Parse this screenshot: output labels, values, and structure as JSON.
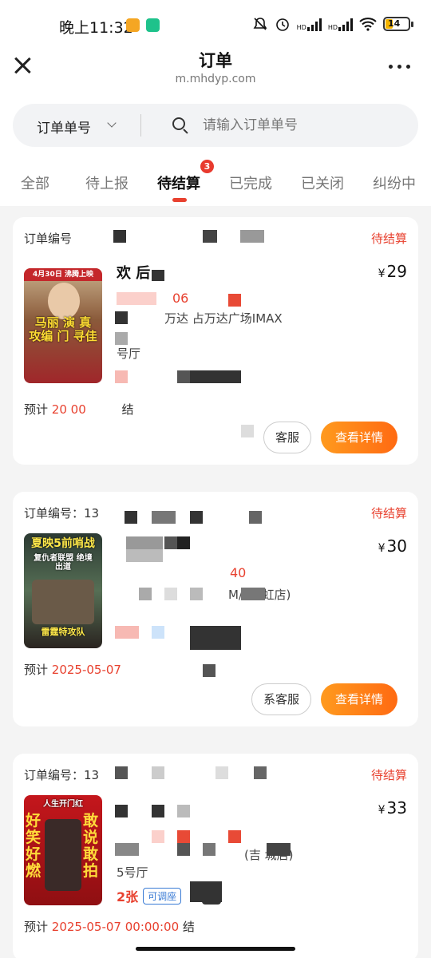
{
  "status_bar": {
    "time": "晚上11:32",
    "signal1_label": "HD",
    "signal2_label": "HD",
    "battery": "14",
    "icons": [
      "mute-icon",
      "alarm-icon",
      "signal-icon",
      "wifi-icon",
      "battery-icon"
    ]
  },
  "header": {
    "title": "订单",
    "url": "m.mhdyp.com",
    "close_icon": "close-icon",
    "more_icon": "more-icon"
  },
  "search": {
    "type_label": "订单单号",
    "placeholder": "请输入订单单号"
  },
  "tabs": [
    {
      "label": "全部"
    },
    {
      "label": "待上报"
    },
    {
      "label": "待结算",
      "badge": "3"
    },
    {
      "label": "已完成"
    },
    {
      "label": "已关闭"
    },
    {
      "label": "纠纷中"
    }
  ],
  "orders": [
    {
      "order_no_prefix": "订单编号",
      "status": "待结算",
      "price_symbol": "¥",
      "price": "29",
      "title_visible": "   欢  后",
      "time_visible": "06",
      "cinema_visible": "万达          占万达广场IMAX",
      "extra_visible": "号厅",
      "eta_label": "预计",
      "eta_time": "20      00",
      "eta_suffix": "结",
      "service_label": "客服",
      "detail_label": "查看详情",
      "poster_top": "4月30日 沸腾上映",
      "poster_main": "马丽 演 真 攻编 门 寻佳"
    },
    {
      "order_no_prefix": "订单编号：13",
      "status": "待结算",
      "price_symbol": "¥",
      "price": "30",
      "time_visible": "40",
      "cinema_visible": "M/   新   虹店)",
      "eta_label": "预计",
      "eta_time": "2025-05-07",
      "service_label": "系客服",
      "detail_label": "查看详情",
      "poster_top": "夏映5前哨战",
      "poster_sub": "复仇者联盟 绝境出道",
      "poster_bottom": "雷霆特攻队"
    },
    {
      "order_no_prefix": "订单编号：13",
      "status": "待结算",
      "price_symbol": "¥",
      "price": "33",
      "cinema_visible": "(吉    城店)",
      "extra_visible": "5号厅",
      "tickets": "2张",
      "seat_tag": "可调座",
      "seat_pick": "座",
      "eta_label": "预计",
      "eta_time": "2025-05-07 00:00:00",
      "eta_suffix": "结",
      "poster_left": "好笑好燃",
      "poster_right": "敢说敢拍",
      "poster_top": "人生开门红"
    }
  ]
}
